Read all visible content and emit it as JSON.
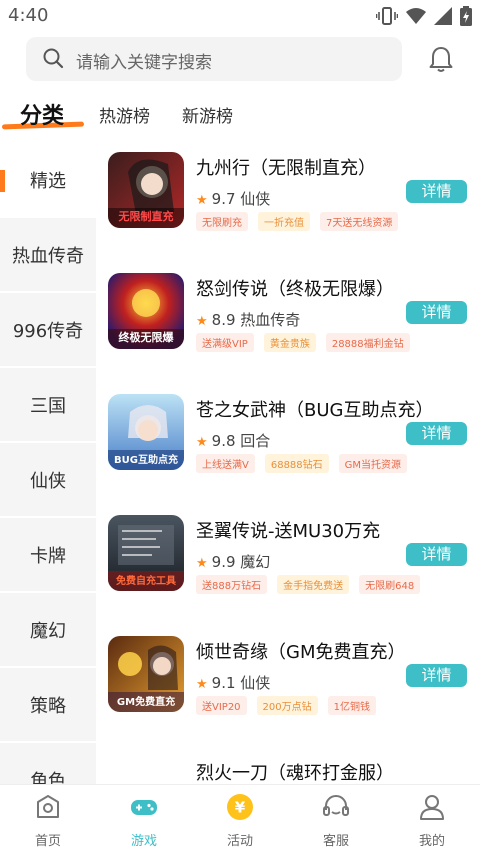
{
  "status": {
    "time": "4:40"
  },
  "search": {
    "placeholder": "请输入关键字搜索"
  },
  "top_tabs": [
    "分类",
    "热游榜",
    "新游榜"
  ],
  "sidebar": [
    "精选",
    "热血传奇",
    "996传奇",
    "三国",
    "仙侠",
    "卡牌",
    "魔幻",
    "策略",
    "角色"
  ],
  "games": [
    {
      "name": "九州行（无限制直充）",
      "rating": "9.7",
      "genre": "仙侠",
      "tags": [
        "无限刷充",
        "一折充值",
        "7天送无线资源"
      ],
      "button": "详情",
      "thumb_text": "无限制直充"
    },
    {
      "name": "怒剑传说（终极无限爆）",
      "rating": "8.9",
      "genre": "热血传奇",
      "tags": [
        "送满级VIP",
        "黄金贵族",
        "28888福利金钻"
      ],
      "button": "详情",
      "thumb_text": "终极无限爆"
    },
    {
      "name": "苍之女武神（BUG互助点充）",
      "rating": "9.8",
      "genre": "回合",
      "tags": [
        "上线送满V",
        "68888钻石",
        "GM当托资源"
      ],
      "button": "详情",
      "thumb_text": "BUG互助点充"
    },
    {
      "name": "圣翼传说-送MU30万充",
      "rating": "9.9",
      "genre": "魔幻",
      "tags": [
        "送888万钻石",
        "金手指免费送",
        "无限刷648"
      ],
      "button": "详情",
      "thumb_text": "免费自充工具"
    },
    {
      "name": "倾世奇缘（GM免费直充）",
      "rating": "9.1",
      "genre": "仙侠",
      "tags": [
        "送VIP20",
        "200万点钻",
        "1亿铜钱"
      ],
      "button": "详情",
      "thumb_text": "GM免费直充"
    },
    {
      "name": "烈火一刀（魂环打金服）",
      "rating": "",
      "genre": "",
      "tags": [],
      "button": "",
      "thumb_text": ""
    }
  ],
  "bottom_nav": [
    "首页",
    "游戏",
    "活动",
    "客服",
    "我的"
  ],
  "colors": {
    "accent": "#ff7a1a",
    "teal": "#3ebfc7"
  }
}
